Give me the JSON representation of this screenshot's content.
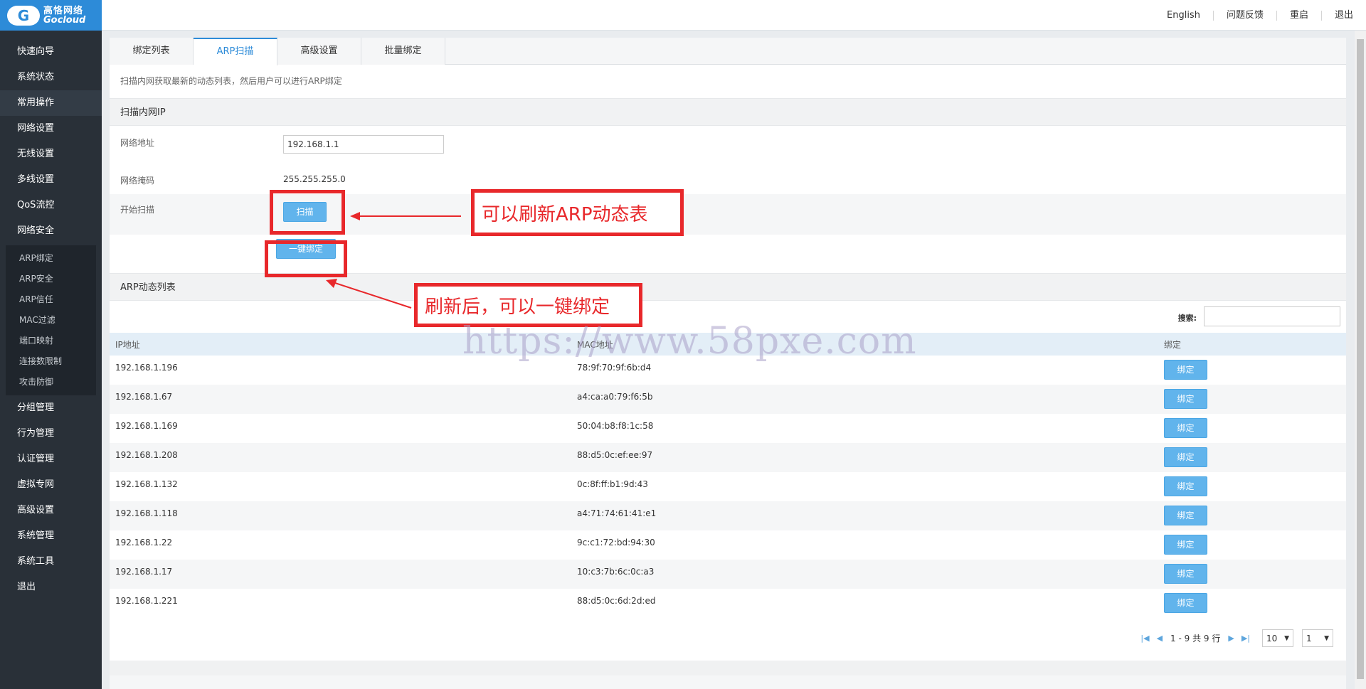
{
  "logo": {
    "cn": "高恪网络",
    "en": "Gocloud"
  },
  "top_links": [
    "English",
    "问题反馈",
    "重启",
    "退出"
  ],
  "sidebar": {
    "items_top": [
      "快速向导",
      "系统状态",
      "常用操作",
      "网络设置",
      "无线设置",
      "多线设置",
      "QoS流控",
      "网络安全"
    ],
    "submenu": [
      "ARP绑定",
      "ARP安全",
      "ARP信任",
      "MAC过滤",
      "端口映射",
      "连接数限制",
      "攻击防御"
    ],
    "items_bottom": [
      "分组管理",
      "行为管理",
      "认证管理",
      "虚拟专网",
      "高级设置",
      "系统管理",
      "系统工具",
      "退出"
    ]
  },
  "tabs": [
    "绑定列表",
    "ARP扫描",
    "高级设置",
    "批量绑定"
  ],
  "description": "扫描内网获取最新的动态列表，然后用户可以进行ARP绑定",
  "scan_section": {
    "title": "扫描内网IP",
    "network_label": "网络地址",
    "network_value": "192.168.1.1",
    "mask_label": "网络掩码",
    "mask_value": "255.255.255.0",
    "start_label": "开始扫描",
    "scan_button": "扫描",
    "bind_all_button": "一键绑定"
  },
  "arp_list": {
    "title": "ARP动态列表",
    "search_label": "搜索:",
    "columns": [
      "IP地址",
      "MAC地址",
      "绑定"
    ],
    "bind_button": "绑定",
    "rows": [
      {
        "ip": "192.168.1.196",
        "mac": "78:9f:70:9f:6b:d4"
      },
      {
        "ip": "192.168.1.67",
        "mac": "a4:ca:a0:79:f6:5b"
      },
      {
        "ip": "192.168.1.169",
        "mac": "50:04:b8:f8:1c:58"
      },
      {
        "ip": "192.168.1.208",
        "mac": "88:d5:0c:ef:ee:97"
      },
      {
        "ip": "192.168.1.132",
        "mac": "0c:8f:ff:b1:9d:43"
      },
      {
        "ip": "192.168.1.118",
        "mac": "a4:71:74:61:41:e1"
      },
      {
        "ip": "192.168.1.22",
        "mac": "9c:c1:72:bd:94:30"
      },
      {
        "ip": "192.168.1.17",
        "mac": "10:c3:7b:6c:0c:a3"
      },
      {
        "ip": "192.168.1.221",
        "mac": "88:d5:0c:6d:2d:ed"
      }
    ],
    "pager_text": "1 - 9 共 9 行",
    "page_size": "10",
    "page_num": "1"
  },
  "annotations": {
    "scan_note": "可以刷新ARP动态表",
    "bind_note": "刷新后，可以一键绑定"
  },
  "watermark": "https://www.58pxe.com",
  "colors": {
    "accent": "#2d8bd8",
    "annotation": "#e8282b",
    "sidebar": "#293038",
    "button": "#61b4ec"
  }
}
